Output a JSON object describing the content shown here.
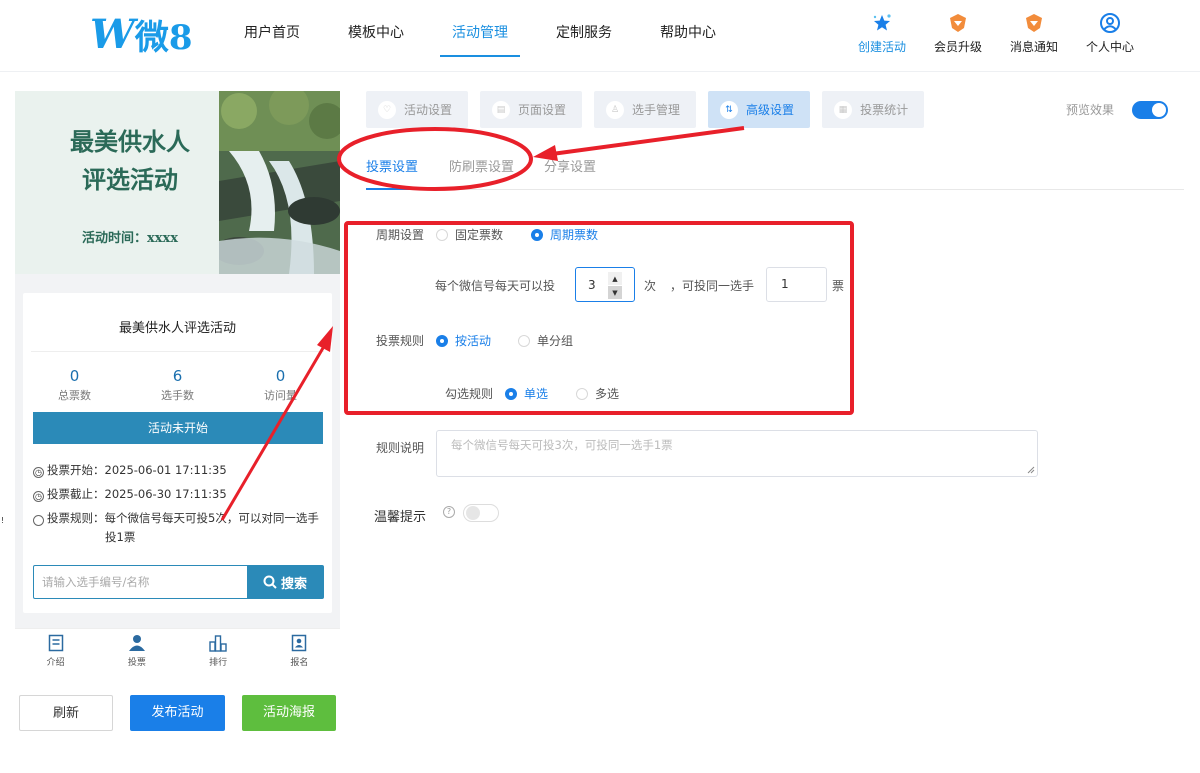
{
  "header": {
    "logo_mark": "W",
    "logo_text": "微8",
    "nav": [
      {
        "label": "用户首页"
      },
      {
        "label": "模板中心"
      },
      {
        "label": "活动管理"
      },
      {
        "label": "定制服务"
      },
      {
        "label": "帮助中心"
      }
    ],
    "tools": [
      {
        "label": "创建活动",
        "icon": "star-icon"
      },
      {
        "label": "会员升级",
        "icon": "shield-icon"
      },
      {
        "label": "消息通知",
        "icon": "bell-icon"
      },
      {
        "label": "个人中心",
        "icon": "user-icon"
      }
    ]
  },
  "preview": {
    "banner_title_line1": "最美供水人",
    "banner_title_line2": "评选活动",
    "banner_time": "活动时间：xxxx",
    "card_title": "最美供水人评选活动",
    "stats": [
      {
        "value": "0",
        "label": "总票数"
      },
      {
        "value": "6",
        "label": "选手数"
      },
      {
        "value": "0",
        "label": "访问量"
      }
    ],
    "status": "活动未开始",
    "vote_start_label": "投票开始：",
    "vote_start": "2025-06-01 17:11:35",
    "vote_end_label": "投票截止：",
    "vote_end": "2025-06-30 17:11:35",
    "vote_rule_label": "投票规则：",
    "vote_rule": "每个微信号每天可投5次，可以对同一选手投1票",
    "search_placeholder": "请输入选手编号/名称",
    "search_button": "搜索",
    "tabs": [
      {
        "label": "介绍",
        "icon": "intro-icon"
      },
      {
        "label": "投票",
        "icon": "vote-person-icon"
      },
      {
        "label": "排行",
        "icon": "rank-icon"
      },
      {
        "label": "报名",
        "icon": "signup-icon"
      }
    ]
  },
  "actions": {
    "refresh": "刷新",
    "publish": "发布活动",
    "poster": "活动海报"
  },
  "settings": {
    "steps": [
      {
        "label": "活动设置",
        "icon": "heart-icon"
      },
      {
        "label": "页面设置",
        "icon": "page-icon"
      },
      {
        "label": "选手管理",
        "icon": "person-icon"
      },
      {
        "label": "高级设置",
        "icon": "sliders-icon"
      },
      {
        "label": "投票统计",
        "icon": "chart-icon"
      }
    ],
    "preview_label": "预览效果",
    "preview_on": true,
    "subtabs": [
      {
        "label": "投票设置"
      },
      {
        "label": "防刷票设置"
      },
      {
        "label": "分享设置"
      }
    ],
    "period_label": "周期设置",
    "period_opt_fixed": "固定票数",
    "period_opt_cycle": "周期票数",
    "per_day_label": "每个微信号每天可以投",
    "per_day_value": "3",
    "per_day_unit": "次",
    "same_player_label": "，可投同一选手",
    "same_player_value": "1",
    "same_player_unit": "票",
    "rule_label": "投票规则",
    "rule_opt_activity": "按活动",
    "rule_opt_group": "单分组",
    "check_label": "勾选规则",
    "check_opt_single": "单选",
    "check_opt_multi": "多选",
    "desc_label": "规则说明",
    "desc_placeholder": "每个微信号每天可投3次，可投同一选手1票",
    "tip_label": "温馨提示",
    "tip_on": false
  },
  "colors": {
    "accent": "#1a7fe8",
    "annotation": "#e8202a",
    "status_bar": "#2b8ab8",
    "poster_button": "#5ebe3e"
  }
}
